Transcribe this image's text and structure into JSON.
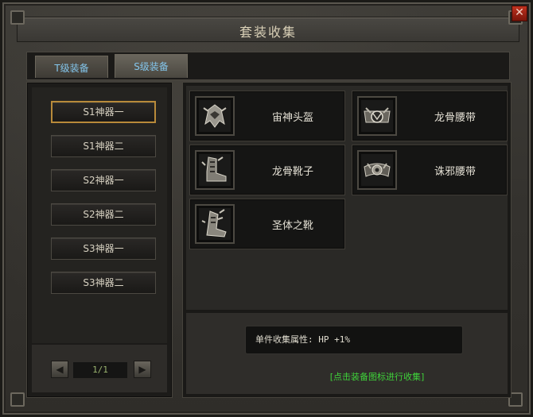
{
  "window": {
    "title": "套装收集",
    "close_label": "✕"
  },
  "tabs": [
    {
      "label": "T级装备",
      "active": false
    },
    {
      "label": "S级装备",
      "active": true
    }
  ],
  "sidebar": {
    "items": [
      {
        "label": "S1神器一",
        "selected": true
      },
      {
        "label": "S1神器二",
        "selected": false
      },
      {
        "label": "S2神器一",
        "selected": false
      },
      {
        "label": "S2神器二",
        "selected": false
      },
      {
        "label": "S3神器一",
        "selected": false
      },
      {
        "label": "S3神器二",
        "selected": false
      }
    ],
    "pager": {
      "prev_label": "◀",
      "next_label": "▶",
      "page_text": "1/1"
    }
  },
  "items": [
    {
      "name": "宙神头盔",
      "icon": "helmet-icon"
    },
    {
      "name": "龙骨腰带",
      "icon": "belt-icon"
    },
    {
      "name": "龙骨靴子",
      "icon": "boots-icon"
    },
    {
      "name": "诛邪腰带",
      "icon": "belt-icon"
    },
    {
      "name": "圣体之靴",
      "icon": "boots-icon"
    }
  ],
  "attribute": {
    "text": "单件收集属性: HP +1%"
  },
  "hint": {
    "text": "[点击装备图标进行收集]"
  },
  "colors": {
    "tab_text": "#84c6ec",
    "hint_text": "#3fd23a",
    "selected_border": "#b88a3a",
    "close_button": "#c0321f"
  }
}
